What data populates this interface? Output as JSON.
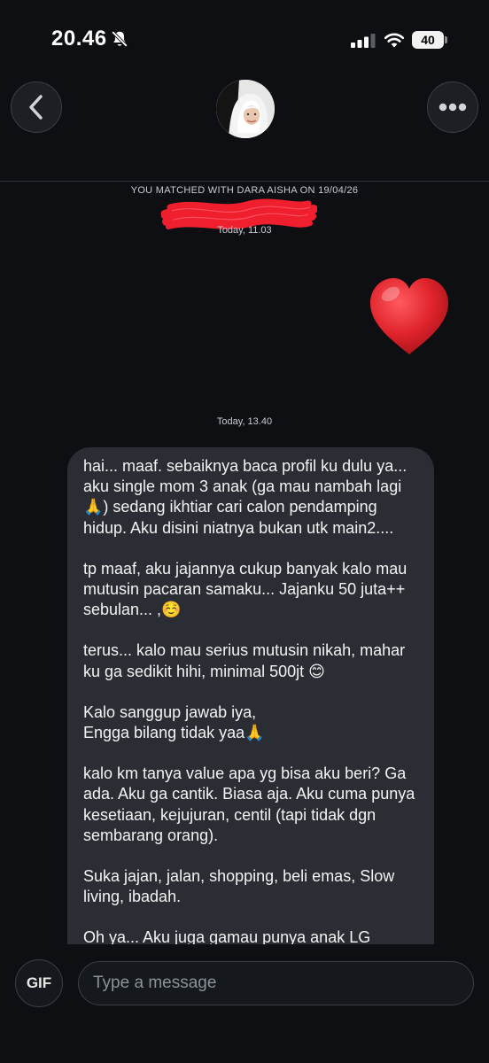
{
  "status_bar": {
    "time": "20.46",
    "battery": "40"
  },
  "header": {
    "back_icon": "chevron-left-icon",
    "more_icon": "ellipsis-icon"
  },
  "chat": {
    "match_notice": "YOU MATCHED WITH DARA AISHA ON 19/04/26",
    "timestamp_1": "Today, 11.03",
    "timestamp_2": "Today, 13.40",
    "sent_emoji": "❤️",
    "received_paragraphs": [
      "hai... maaf. sebaiknya baca profil ku dulu ya... aku single mom 3 anak (ga mau nambah lagi 🙏) sedang ikhtiar cari calon pendamping hidup. Aku disini niatnya bukan utk main2....",
      "tp maaf, aku jajannya cukup banyak kalo mau mutusin pacaran samaku... Jajanku 50 juta++ sebulan... ,☺️",
      "terus... kalo mau serius mutusin nikah, mahar ku ga sedikit hihi, minimal 500jt 😊",
      "Kalo sanggup jawab iya,\nEngga bilang tidak yaa🙏",
      "kalo km tanya value apa yg bisa aku beri? Ga ada. Aku ga cantik. Biasa aja. Aku cuma punya kesetiaan, kejujuran, centil (tapi tidak dgn sembarang orang).",
      "Suka jajan, jalan, shopping, beli emas, Slow living, ibadah.",
      "Oh ya... Aku juga gamau punya anak LG"
    ]
  },
  "composer": {
    "gif_label": "GIF",
    "placeholder": "Type a message"
  },
  "colors": {
    "background": "#0d0f12",
    "bubble": "#2a2d33",
    "heart": "#e0242c"
  }
}
